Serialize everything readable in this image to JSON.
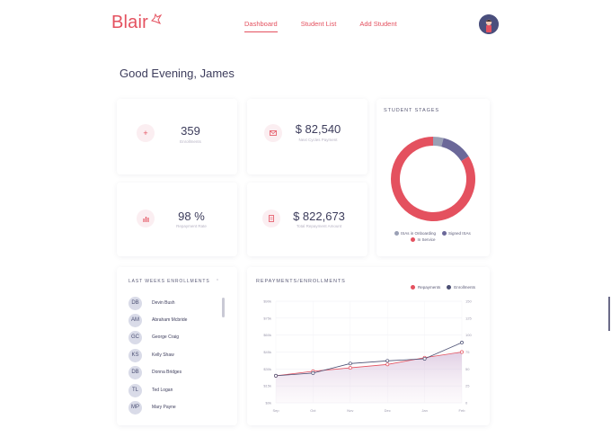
{
  "app": {
    "logo": "Blair"
  },
  "nav": {
    "items": [
      {
        "label": "Dashboard",
        "active": true
      },
      {
        "label": "Student List",
        "active": false
      },
      {
        "label": "Add Student",
        "active": false
      }
    ]
  },
  "greeting": "Good Evening, James",
  "stats": [
    {
      "icon": "plus-icon",
      "value": "359",
      "label": "Enrollments"
    },
    {
      "icon": "mail-icon",
      "value": "$ 82,540",
      "label": "Next Cycles Payment"
    },
    {
      "icon": "bar-chart-icon",
      "value": "98 %",
      "label": "Repayment Rate"
    },
    {
      "icon": "document-icon",
      "value": "$ 822,673",
      "label": "Total Repayment Amount"
    }
  ],
  "stages": {
    "title": "STUDENT STAGES",
    "legend": [
      "ISAs in Onboarding",
      "Signed ISAs",
      "In Service"
    ],
    "colors": {
      "onboarding": "#9aa0b5",
      "signed": "#6b6899",
      "service": "#e4515f"
    },
    "chart_data": {
      "type": "pie",
      "categories": [
        "ISAs in Onboarding",
        "Signed ISAs",
        "In Service"
      ],
      "values": [
        4,
        12,
        84
      ]
    }
  },
  "enrollments": {
    "title": "LAST WEEKS ENROLLMENTS",
    "rows": [
      {
        "initials": "DB",
        "name": "Devin Bush"
      },
      {
        "initials": "AM",
        "name": "Abraham Mcbride"
      },
      {
        "initials": "GC",
        "name": "George Craig"
      },
      {
        "initials": "KS",
        "name": "Kelly Shaw"
      },
      {
        "initials": "DB",
        "name": "Donna Bridges"
      },
      {
        "initials": "TL",
        "name": "Ted Logan"
      },
      {
        "initials": "MP",
        "name": "Mary Payne"
      }
    ]
  },
  "repayments": {
    "title": "REPAYMENTS/ENROLLMENTS",
    "legend": [
      "Repayments",
      "Enrollments"
    ],
    "colors": {
      "repayments": "#e4515f",
      "enrollments": "#4b4f73"
    },
    "chart_data": {
      "type": "line",
      "categories": [
        "Sep",
        "Oct",
        "Nov",
        "Dec",
        "Jan",
        "Feb"
      ],
      "series": [
        {
          "name": "Repayments",
          "axis": "left",
          "values": [
            24,
            28,
            31,
            34,
            40,
            45
          ]
        },
        {
          "name": "Enrollments",
          "axis": "right",
          "values": [
            40,
            44,
            58,
            62,
            65,
            89
          ]
        }
      ],
      "y_left": {
        "ticks": [
          "$0k",
          "$15k",
          "$30k",
          "$45k",
          "$60k",
          "$75k",
          "$90k"
        ],
        "ylim": [
          0,
          90
        ]
      },
      "y_right": {
        "ticks": [
          "0",
          "25",
          "50",
          "75",
          "100",
          "125",
          "150"
        ],
        "ylim": [
          0,
          150
        ]
      }
    }
  }
}
